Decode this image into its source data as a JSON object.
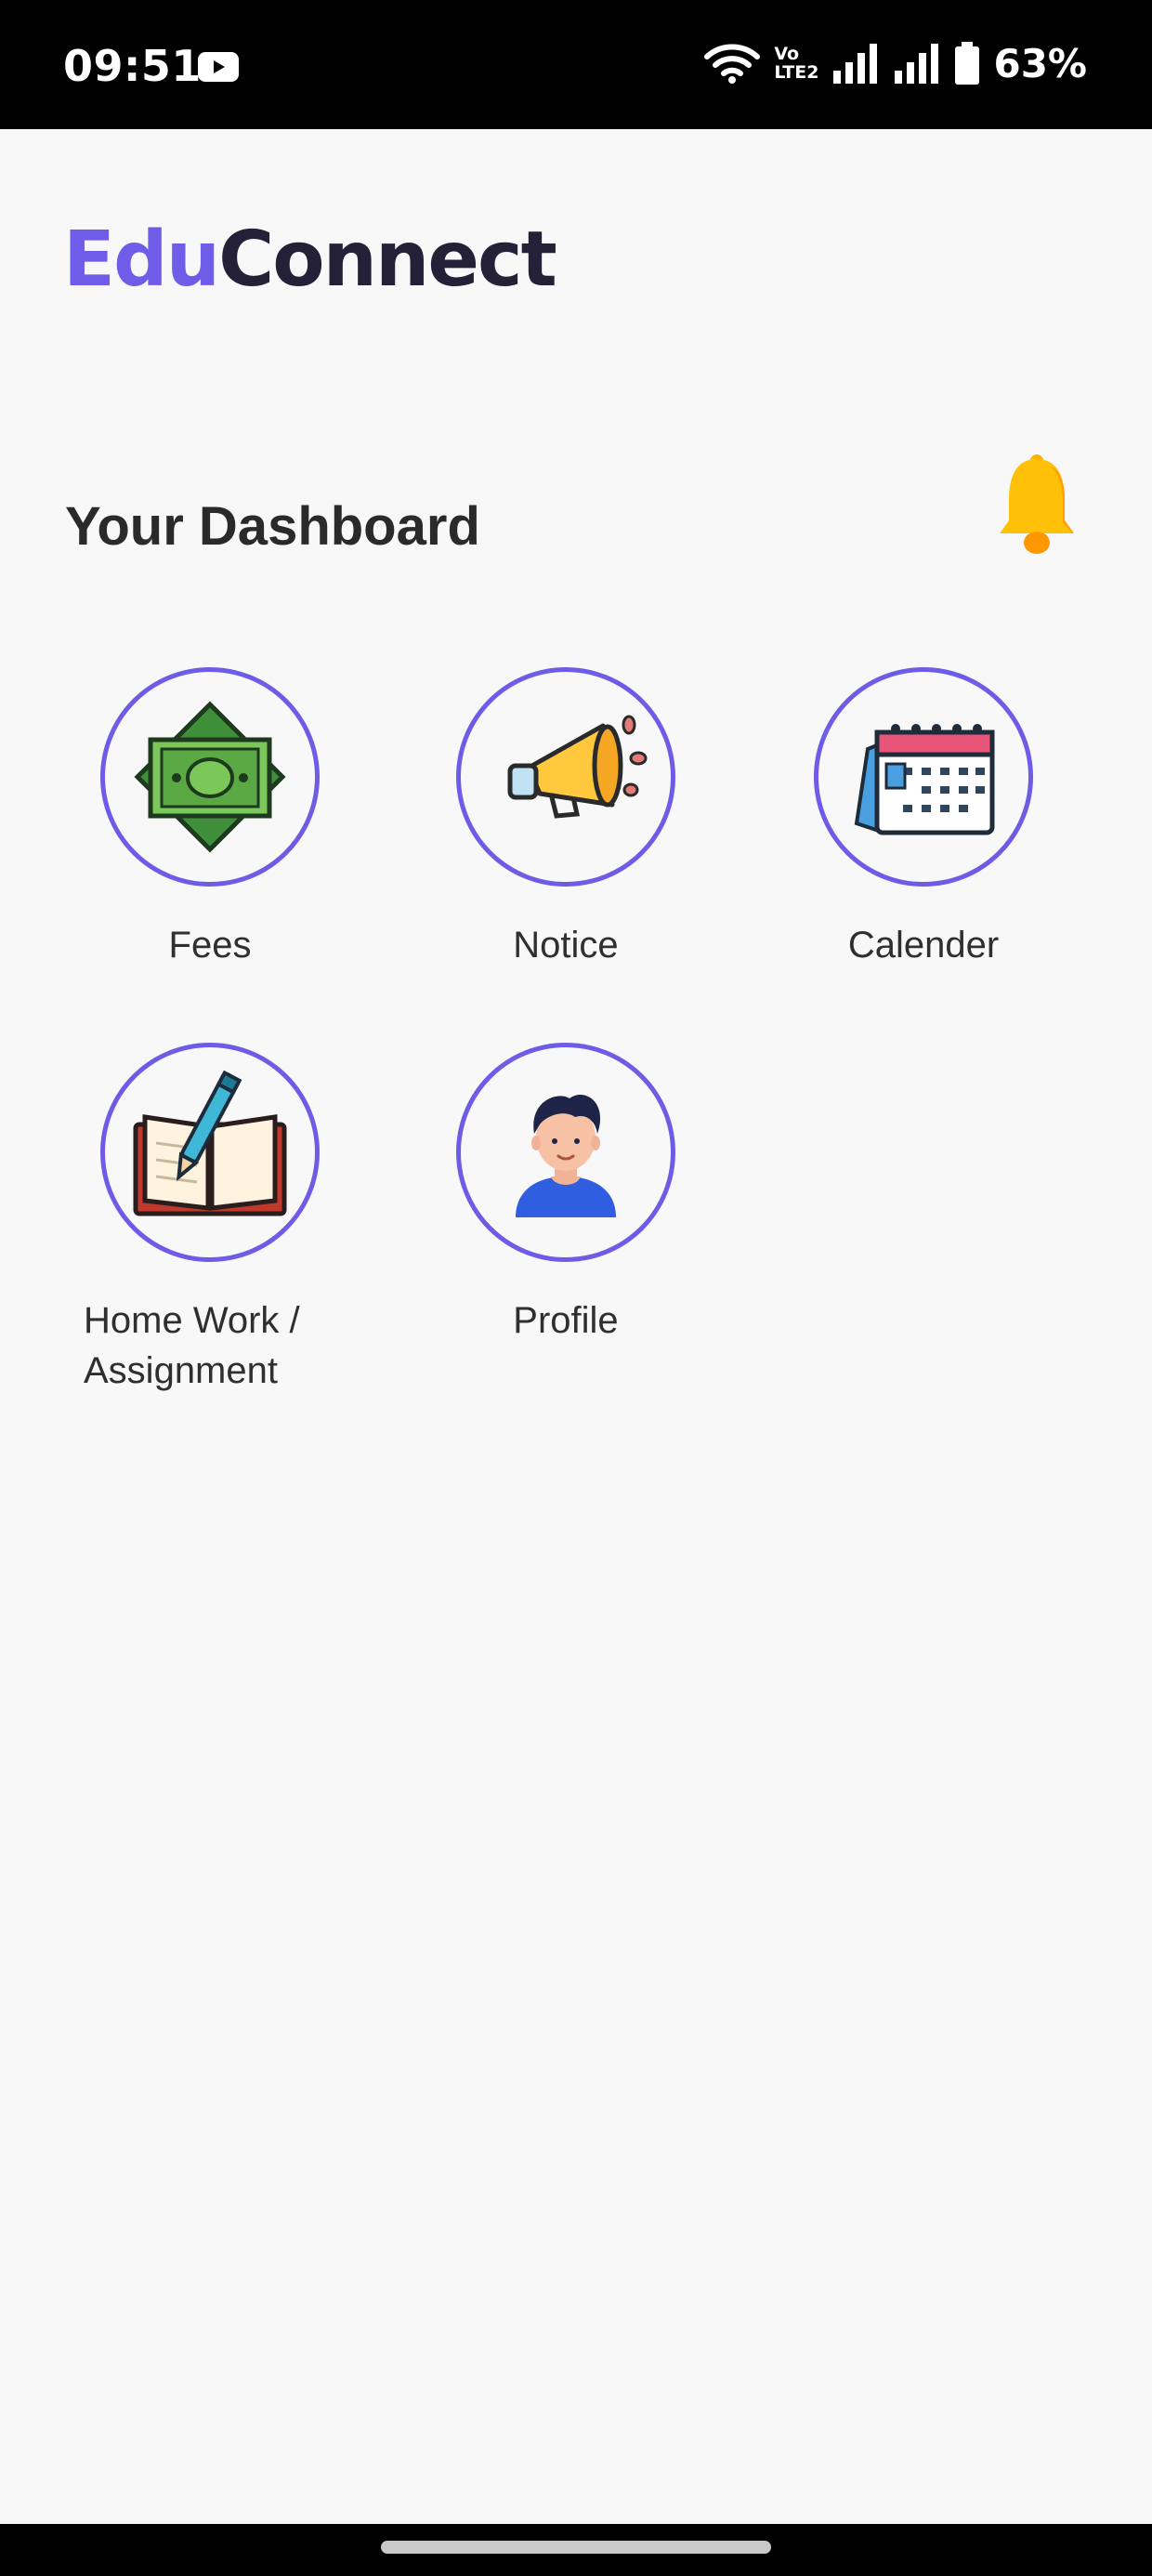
{
  "status_bar": {
    "time": "09:51",
    "network_label_top": "Vo",
    "network_label_bottom": "LTE2",
    "battery": "63%",
    "icons": [
      "youtube-icon",
      "wifi-icon",
      "volte-icon",
      "signal-icon",
      "signal-icon",
      "battery-icon"
    ]
  },
  "app": {
    "logo_part1": "Edu",
    "logo_part2": "Connect",
    "brand_colors": {
      "edu": "#6f5ce8",
      "connect": "#232038",
      "ring": "#6e5ce6",
      "bell": "#ffb300"
    }
  },
  "dashboard": {
    "title": "Your Dashboard",
    "notification_icon": "bell-icon",
    "tiles": [
      {
        "label": "Fees",
        "icon": "money-icon"
      },
      {
        "label": "Notice",
        "icon": "megaphone-icon"
      },
      {
        "label": "Calender",
        "icon": "calendar-icon"
      },
      {
        "label_line1": "Home Work /",
        "label_line2": "Assignment",
        "icon": "book-pen-icon"
      },
      {
        "label": "Profile",
        "icon": "avatar-icon"
      }
    ]
  }
}
